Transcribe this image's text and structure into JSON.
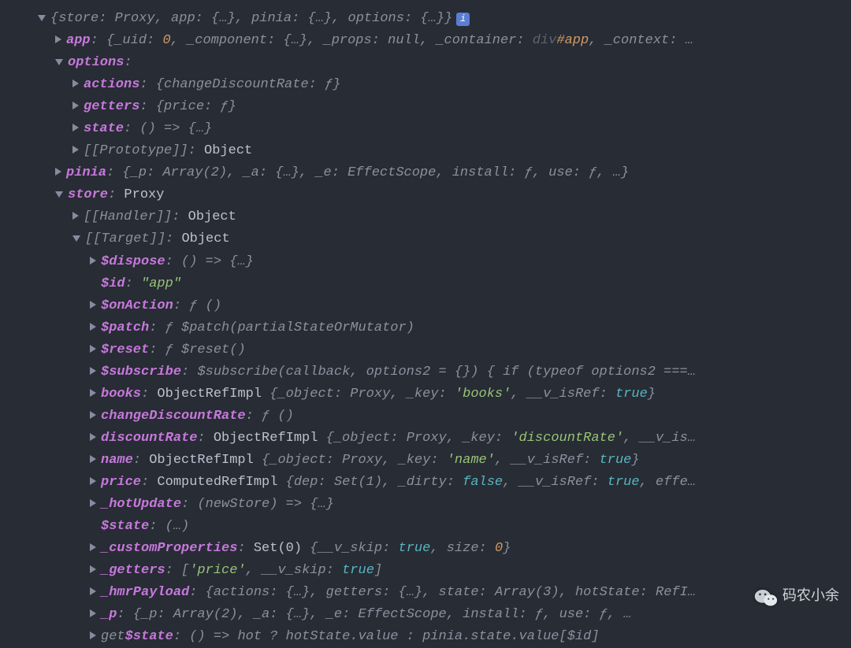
{
  "root_summary": {
    "open": "{",
    "pairs": [
      {
        "k": "store",
        "v": "Proxy"
      },
      {
        "k": "app",
        "v": "{…}"
      },
      {
        "k": "pinia",
        "v": "{…}"
      },
      {
        "k": "options",
        "v": "{…}"
      }
    ],
    "close": "}"
  },
  "app_line": {
    "key": "app",
    "open": "{",
    "close": "…",
    "uid_k": "_uid",
    "uid_v": "0",
    "comp_k": "_component",
    "comp_v": "{…}",
    "props_k": "_props",
    "props_v": "null",
    "cont_k": "_container",
    "cont_sel": "div",
    "cont_id": "#app",
    "ctx_k": "_context"
  },
  "options": {
    "key": "options",
    "colon": ":"
  },
  "opt_actions": {
    "key": "actions",
    "open": "{",
    "fn": "changeDiscountRate",
    "f": "ƒ",
    "close": "}"
  },
  "opt_getters": {
    "key": "getters",
    "open": "{",
    "fn": "price",
    "f": "ƒ",
    "close": "}"
  },
  "opt_state": {
    "key": "state",
    "val": "() => {…}"
  },
  "opt_proto": {
    "key": "[[Prototype]]",
    "val": "Object"
  },
  "pinia_line": {
    "key": "pinia",
    "open": "{",
    "p_k": "_p",
    "p_v": "Array(2)",
    "a_k": "_a",
    "a_v": "{…}",
    "e_k": "_e",
    "e_v": "EffectScope",
    "in_k": "install",
    "in_v": "ƒ",
    "use_k": "use",
    "use_v": "ƒ",
    "close": "…}"
  },
  "store_header": {
    "key": "store",
    "val": "Proxy"
  },
  "handler": {
    "key": "[[Handler]]",
    "val": "Object"
  },
  "target": {
    "key": "[[Target]]",
    "val": "Object"
  },
  "t_dispose": {
    "key": "$dispose",
    "val": "() => {…}"
  },
  "t_id": {
    "key": "$id",
    "val": "\"app\""
  },
  "t_onAction": {
    "key": "$onAction",
    "f": "ƒ",
    "args": "()"
  },
  "t_patch": {
    "key": "$patch",
    "f": "ƒ",
    "sig": "$patch(partialStateOrMutator)"
  },
  "t_reset": {
    "key": "$reset",
    "f": "ƒ",
    "sig": "$reset()"
  },
  "t_subscribe": {
    "key": "$subscribe",
    "sig": "$subscribe(callback, options2 = {}) { if (typeof options2 ===…"
  },
  "t_books": {
    "key": "books",
    "cls": "ObjectRefImpl",
    "open": "{",
    "obj_k": "_object",
    "obj_v": "Proxy",
    "key_k": "_key",
    "key_v": "'books'",
    "ref_k": "__v_isRef",
    "ref_v": "true",
    "close": "}"
  },
  "t_changeDR": {
    "key": "changeDiscountRate",
    "f": "ƒ",
    "args": "()"
  },
  "t_discountRate": {
    "key": "discountRate",
    "cls": "ObjectRefImpl",
    "open": "{",
    "obj_k": "_object",
    "obj_v": "Proxy",
    "key_k": "_key",
    "key_v": "'discountRate'",
    "ref_k": "__v_is…"
  },
  "t_name": {
    "key": "name",
    "cls": "ObjectRefImpl",
    "open": "{",
    "obj_k": "_object",
    "obj_v": "Proxy",
    "key_k": "_key",
    "key_v": "'name'",
    "ref_k": "__v_isRef",
    "ref_v": "true",
    "close": "}"
  },
  "t_price": {
    "key": "price",
    "cls": "ComputedRefImpl",
    "open": "{",
    "dep_k": "dep",
    "dep_v": "Set(1)",
    "dirty_k": "_dirty",
    "dirty_v": "false",
    "ref_k": "__v_isRef",
    "ref_v": "true",
    "tail": "effe…"
  },
  "t_hotUpdate": {
    "key": "_hotUpdate",
    "val": "(newStore) => {…}"
  },
  "t_state": {
    "key": "$state",
    "val": "(…)"
  },
  "t_custom": {
    "key": "_customProperties",
    "cls": "Set(0)",
    "open": "{",
    "skip_k": "__v_skip",
    "skip_v": "true",
    "size_k": "size",
    "size_v": "0",
    "close": "}"
  },
  "t_getters": {
    "key": "_getters",
    "open": "[",
    "v0": "'price'",
    "skip_k": "__v_skip",
    "skip_v": "true",
    "close": "]"
  },
  "t_hmr": {
    "key": "_hmrPayload",
    "open": "{",
    "ac_k": "actions",
    "ac_v": "{…}",
    "ge_k": "getters",
    "ge_v": "{…}",
    "st_k": "state",
    "st_v": "Array(3)",
    "hs_k": "hotState",
    "hs_v": "RefI…"
  },
  "t_p": {
    "key": "_p",
    "open": "{",
    "p_k": "_p",
    "p_v": "Array(2)",
    "a_k": "_a",
    "a_v": "{…}",
    "e_k": "_e",
    "e_v": "EffectScope",
    "in_k": "install",
    "in_v": "ƒ",
    "use_k": "use",
    "use_v": "ƒ",
    "tail": "…"
  },
  "t_getstate": {
    "prefix": "get ",
    "key": "$state",
    "val": "() => hot ? hotState.value : pinia.state.value[$id]"
  },
  "watermark": "码农小余"
}
